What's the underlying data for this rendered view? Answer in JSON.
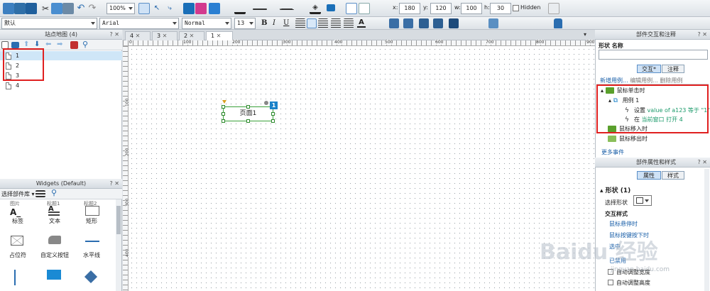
{
  "toolbar": {
    "zoom": "100%",
    "x_label": "x:",
    "x_value": "180",
    "y_label": "y:",
    "y_value": "120",
    "w_label": "w:",
    "w_value": "100",
    "h_label": "h:",
    "h_value": "30",
    "hidden_label": "Hidden",
    "style_select": "默认",
    "font_family": "Arial",
    "font_weight": "Normal",
    "font_size": "13",
    "bold": "B",
    "italic": "I",
    "underline": "U",
    "text_color": "A"
  },
  "sitemap": {
    "title": "站点地图 (4)",
    "controls": "? ✕",
    "pages": [
      "1",
      "2",
      "3",
      "4"
    ],
    "highlight_color": "#e02020"
  },
  "widgets": {
    "title": "Widgets (Default)",
    "controls": "? ✕",
    "library": "选择部件库",
    "top_partial": [
      "图片",
      "标题1",
      "标题2"
    ],
    "items": [
      {
        "label": "标签",
        "icon": "label-icon"
      },
      {
        "label": "文本",
        "icon": "text-icon"
      },
      {
        "label": "矩形",
        "icon": "rectangle-icon"
      },
      {
        "label": "占位符",
        "icon": "placeholder-icon"
      },
      {
        "label": "自定义按钮",
        "icon": "custom-button-icon"
      },
      {
        "label": "水平线",
        "icon": "horizontal-line-icon"
      }
    ]
  },
  "canvas": {
    "tabs": [
      "4",
      "3",
      "2",
      "1"
    ],
    "ruler_h": [
      "0",
      "100",
      "200",
      "300",
      "400",
      "500",
      "600",
      "700",
      "800",
      "900"
    ],
    "ruler_v": [
      "100",
      "200",
      "300",
      "400"
    ],
    "widget_text": "页面1",
    "widget_badge": "1"
  },
  "interaction": {
    "title": "部件交互和注释",
    "controls": "? ✕",
    "shape_name_label": "形状 名称",
    "tab_interaction": "交互",
    "tab_notes": "注释",
    "add_case": "新增用例...",
    "edit_case": "编辑用例...",
    "delete_case": "删除用例",
    "event_click": "鼠标单击时",
    "case1": "用例 1",
    "action1_prefix": "设置",
    "action1_value": "value of a123 等于 \"1\"",
    "action2_prefix": "在",
    "action2_target": "当前窗口",
    "action2_suffix": "打开 4",
    "event_enter": "鼠标移入时",
    "event_leave": "鼠标移出时",
    "more_events": "更多事件"
  },
  "properties": {
    "title": "部件属性和样式",
    "controls": "? ✕",
    "tab_props": "属性",
    "tab_style": "样式",
    "section_shape": "形状 (1)",
    "select_shape": "选择形状",
    "interaction_style": "交互样式",
    "link_hover": "鼠标悬停时",
    "link_down": "鼠标按键按下时",
    "link_selected": "选中",
    "link_disabled": "已禁用",
    "auto_width": "自动调整宽度",
    "auto_height": "自动调整高度"
  },
  "watermark": {
    "brand": "Baidu 经验",
    "url": "jingyan.baidu.com"
  }
}
